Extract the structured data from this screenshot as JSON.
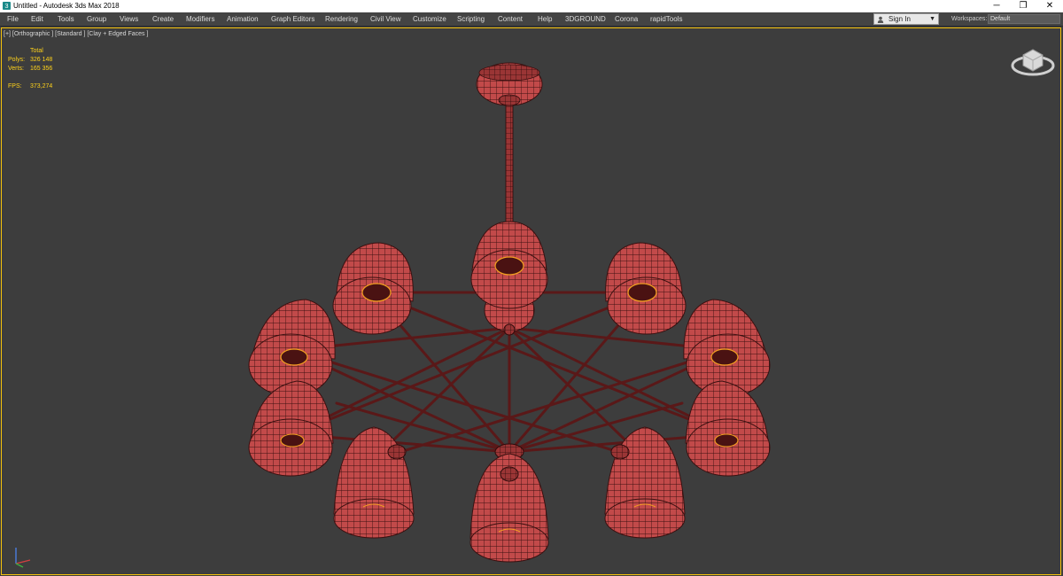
{
  "window": {
    "title": "Untitled - Autodesk 3ds Max 2018",
    "controls": [
      "─",
      "❐",
      "✕"
    ]
  },
  "menu": [
    "File",
    "Edit",
    "Tools",
    "Group",
    "Views",
    "Create",
    "Modifiers",
    "Animation",
    "Graph Editors",
    "Rendering",
    "Civil View",
    "Customize",
    "Scripting",
    "Content",
    "Help",
    "3DGROUND",
    "Corona",
    "rapidTools"
  ],
  "account": {
    "sign_in": "Sign In"
  },
  "workspaces": {
    "label": "Workspaces:",
    "value": "Default"
  },
  "viewport": {
    "label": "[+] [Orthographic ] [Standard ] [Clay + Edged Faces ]",
    "stats": {
      "total_label": "Total",
      "polys_label": "Polys:",
      "polys_value": "326 148",
      "verts_label": "Verts:",
      "verts_value": "165 356",
      "fps_label": "FPS:",
      "fps_value": "373,274"
    }
  },
  "colors": {
    "clay": "#c24a4a",
    "wire": "#3a1010",
    "bulb": "#f2a020",
    "viewport_border": "#f5c20b",
    "stats_text": "#ffd21a"
  }
}
